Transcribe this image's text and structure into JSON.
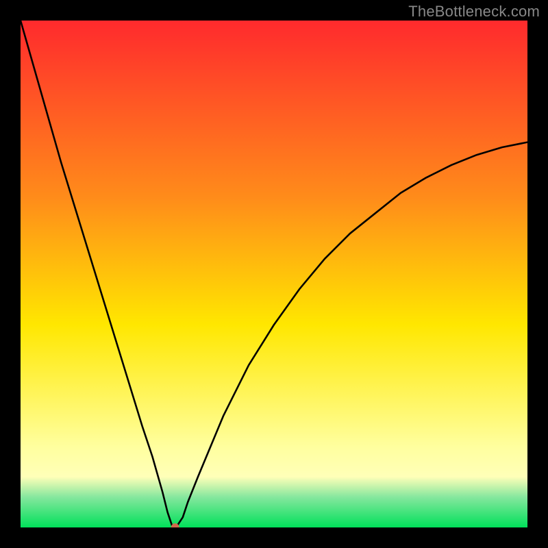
{
  "watermark": "TheBottleneck.com",
  "colors": {
    "bg": "#000000",
    "grad_top": "#ff2a2d",
    "grad_mid1": "#ff8c1a",
    "grad_mid2": "#ffe700",
    "grad_yellowband_top": "#ffff9e",
    "grad_yellowband_bot": "#ffffb8",
    "grad_green_top": "#86e79e",
    "grad_green_bot": "#00e05a",
    "curve_stroke": "#000000",
    "dot_fill": "#d06a4c",
    "watermark_text": "#888888"
  },
  "chart_data": {
    "type": "line",
    "title": "",
    "xlabel": "",
    "ylabel": "",
    "xlim": [
      0,
      100
    ],
    "ylim": [
      0,
      100
    ],
    "x": [
      0,
      4,
      8,
      12,
      16,
      20,
      24,
      26,
      28,
      29,
      30,
      30.5,
      31,
      32,
      33,
      35,
      40,
      45,
      50,
      55,
      60,
      65,
      70,
      75,
      80,
      85,
      90,
      95,
      100
    ],
    "values": [
      100,
      86,
      72,
      59,
      46,
      33,
      20,
      14,
      7,
      3,
      0,
      0,
      0.5,
      2,
      5,
      10,
      22,
      32,
      40,
      47,
      53,
      58,
      62,
      66,
      69,
      71.5,
      73.5,
      75,
      76
    ],
    "minimum_x": 30.5,
    "minimum_y": 0,
    "description": "Bottleneck percentage vs. component score. Minimum at x≈30.5 indicates ideal match; curve rises left (linear) and right (asymptotic)."
  }
}
